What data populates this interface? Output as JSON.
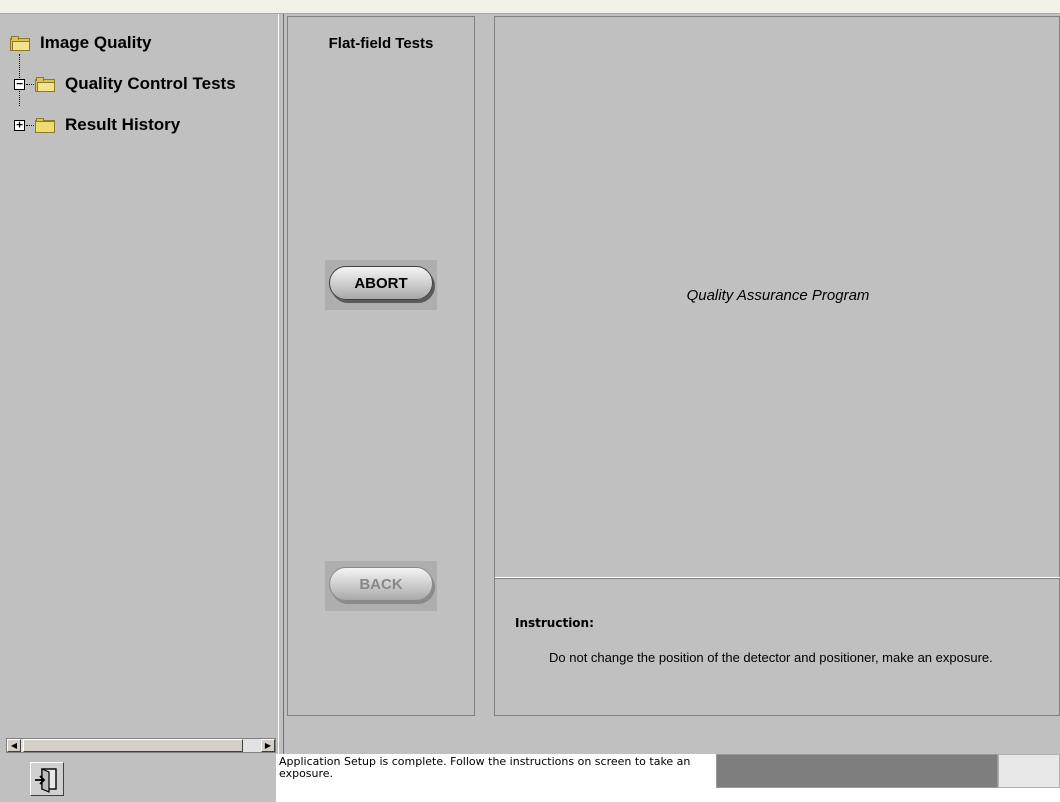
{
  "tree": {
    "root_label": "Image Quality",
    "items": [
      {
        "label": "Quality Control Tests",
        "expander": "−"
      },
      {
        "label": "Result History",
        "expander": "+"
      }
    ]
  },
  "middle": {
    "title": "Flat-field Tests",
    "abort_label": "ABORT",
    "back_label": "BACK"
  },
  "right": {
    "program_title": "Quality Assurance Program",
    "instruction_label": "Instruction:",
    "instruction_text": "Do not change the position of the detector and positioner, make an exposure."
  },
  "status": {
    "message": "Application Setup is complete. Follow the instructions on screen to take an exposure.",
    "progress": 1.0
  },
  "icons": {
    "exit": "exit-door-icon",
    "folder": "folder-icon",
    "scroll_left": "◀",
    "scroll_right": "▶"
  }
}
